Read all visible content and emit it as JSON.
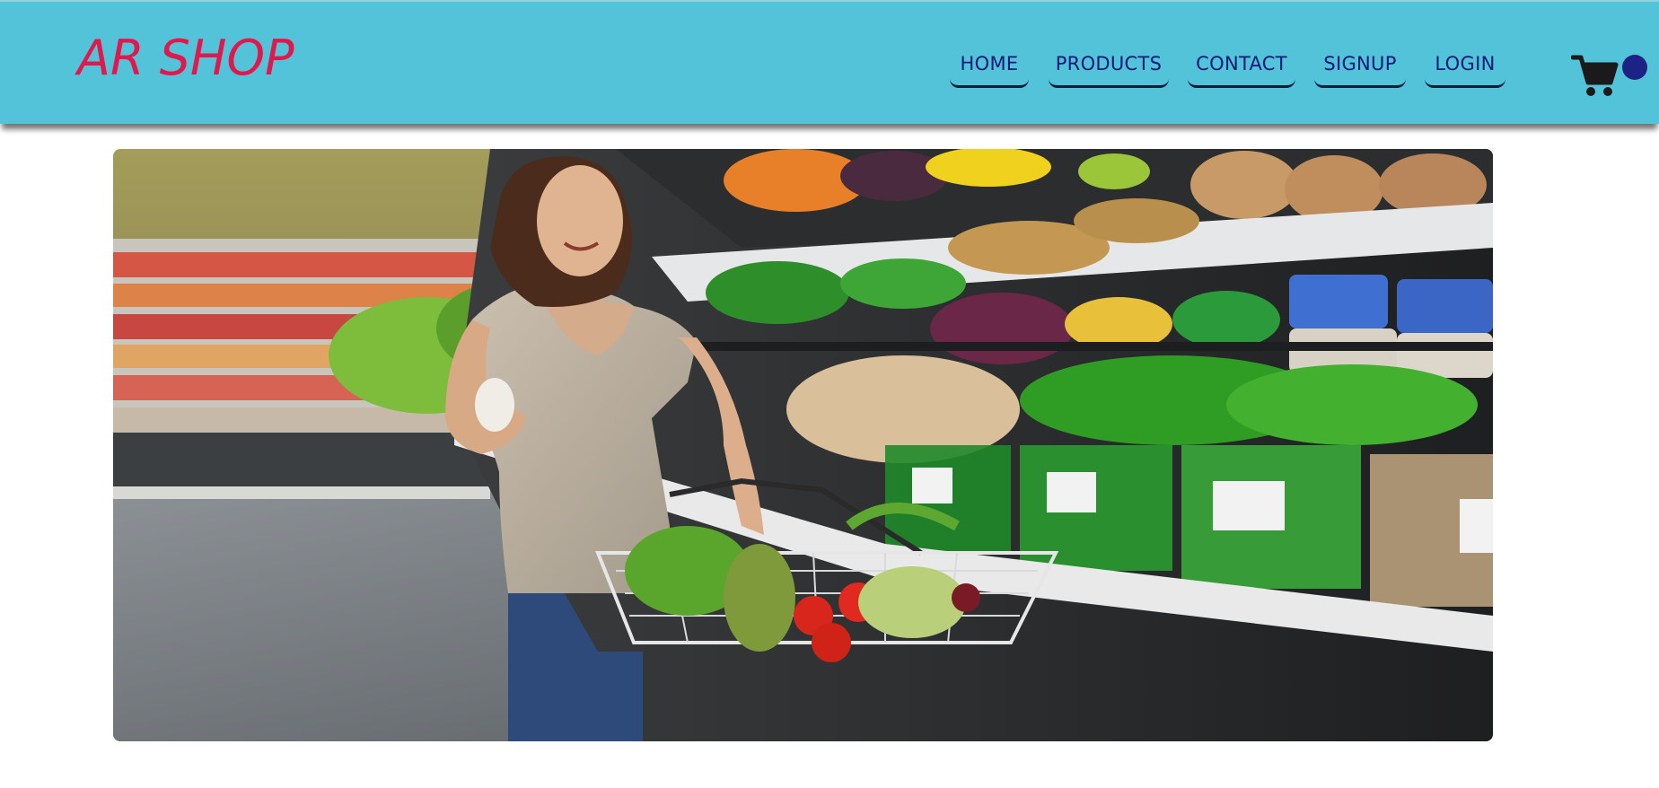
{
  "brand": {
    "name": "AR SHOP",
    "color": "#e2184d"
  },
  "nav": {
    "items": [
      {
        "label": "HOME"
      },
      {
        "label": "PRODUCTS"
      },
      {
        "label": "CONTACT"
      },
      {
        "label": "SIGNUP"
      },
      {
        "label": "LOGIN"
      }
    ]
  },
  "cart": {
    "icon": "shopping-cart-icon"
  },
  "hero": {
    "image": "woman-shopping-groceries-photo"
  },
  "colors": {
    "navbar_bg": "#52c3d8",
    "nav_text": "#121a78",
    "badge": "#1d2384"
  }
}
